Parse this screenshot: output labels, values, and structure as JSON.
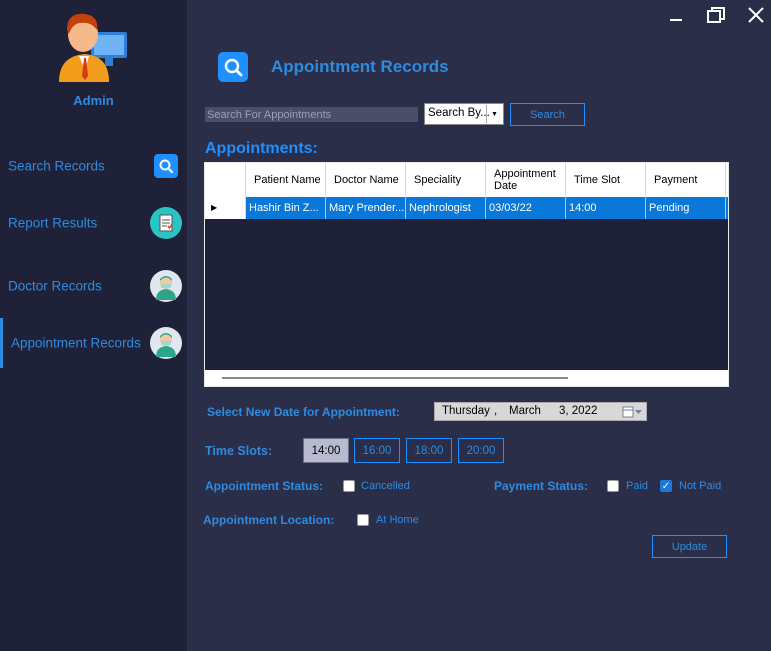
{
  "window": {
    "minimize_icon": "minimize-icon",
    "restore_icon": "restore-icon",
    "close_icon": "close-icon"
  },
  "sidebar": {
    "user_label": "Admin",
    "items": [
      {
        "label": "Search Records",
        "icon": "search-icon"
      },
      {
        "label": "Report Results",
        "icon": "report-icon"
      },
      {
        "label": "Doctor Records",
        "icon": "doctor-icon"
      },
      {
        "label": "Appointment Records",
        "icon": "doctor-icon",
        "active": true
      }
    ]
  },
  "header": {
    "title": "Appointment Records"
  },
  "search": {
    "placeholder": "Search For Appointments",
    "search_by": "Search By...",
    "button": "Search"
  },
  "table": {
    "title": "Appointments:",
    "columns": [
      "Patient Name",
      "Doctor Name",
      "Speciality",
      "Appointment Date",
      "Time Slot",
      "Payment"
    ],
    "rows": [
      [
        "Hashir Bin Z...",
        "Mary Prender...",
        "Nephrologist",
        "03/03/22",
        "14:00",
        "Pending"
      ]
    ]
  },
  "form": {
    "date_label": "Select New Date for Appointment:",
    "date": {
      "weekday": "Thursday",
      "sep1": ",",
      "month": "March",
      "day_year": "3, 2022"
    },
    "slots_label": "Time Slots:",
    "slots": [
      "14:00",
      "16:00",
      "18:00",
      "20:00"
    ],
    "selected_slot": "14:00",
    "status_label": "Appointment Status:",
    "cancelled_label": "Cancelled",
    "payment_label": "Payment Status:",
    "paid_label": "Paid",
    "not_paid_label": "Not Paid",
    "location_label": "Appointment Location:",
    "at_home_label": "At Home",
    "update_button": "Update"
  },
  "colors": {
    "accent": "#1e90ff",
    "sidebar_bg": "#1f2138",
    "main_bg": "#2a2e48",
    "selected_row": "#0a78d8"
  }
}
